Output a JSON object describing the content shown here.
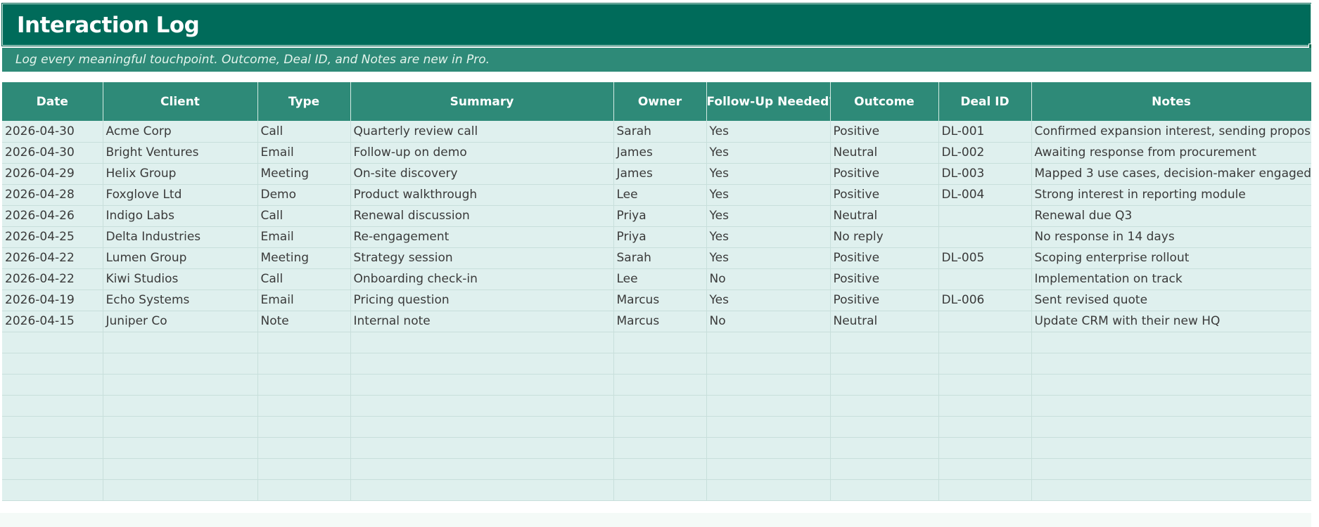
{
  "sheet": {
    "title": "Interaction Log",
    "subtitle": "Log every meaningful touchpoint. Outcome, Deal ID, and Notes are new in Pro."
  },
  "colors": {
    "title_bg": "#006b5a",
    "header_bg": "#2e8a78",
    "row_bg": "#dff0ee"
  },
  "columns": [
    "Date",
    "Client",
    "Type",
    "Summary",
    "Owner",
    "Follow-Up Needed?",
    "Outcome",
    "Deal ID",
    "Notes"
  ],
  "rows": [
    [
      "2026-04-30",
      "Acme Corp",
      "Call",
      "Quarterly review call",
      "Sarah",
      "Yes",
      "Positive",
      "DL-001",
      "Confirmed expansion interest, sending proposal"
    ],
    [
      "2026-04-30",
      "Bright Ventures",
      "Email",
      "Follow-up on demo",
      "James",
      "Yes",
      "Neutral",
      "DL-002",
      "Awaiting response from procurement"
    ],
    [
      "2026-04-29",
      "Helix Group",
      "Meeting",
      "On-site discovery",
      "James",
      "Yes",
      "Positive",
      "DL-003",
      "Mapped 3 use cases, decision-maker engaged"
    ],
    [
      "2026-04-28",
      "Foxglove Ltd",
      "Demo",
      "Product walkthrough",
      "Lee",
      "Yes",
      "Positive",
      "DL-004",
      "Strong interest in reporting module"
    ],
    [
      "2026-04-26",
      "Indigo Labs",
      "Call",
      "Renewal discussion",
      "Priya",
      "Yes",
      "Neutral",
      "",
      "Renewal due Q3"
    ],
    [
      "2026-04-25",
      "Delta Industries",
      "Email",
      "Re-engagement",
      "Priya",
      "Yes",
      "No reply",
      "",
      "No response in 14 days"
    ],
    [
      "2026-04-22",
      "Lumen Group",
      "Meeting",
      "Strategy session",
      "Sarah",
      "Yes",
      "Positive",
      "DL-005",
      "Scoping enterprise rollout"
    ],
    [
      "2026-04-22",
      "Kiwi Studios",
      "Call",
      "Onboarding check-in",
      "Lee",
      "No",
      "Positive",
      "",
      "Implementation on track"
    ],
    [
      "2026-04-19",
      "Echo Systems",
      "Email",
      "Pricing question",
      "Marcus",
      "Yes",
      "Positive",
      "DL-006",
      "Sent revised quote"
    ],
    [
      "2026-04-15",
      "Juniper Co",
      "Note",
      "Internal note",
      "Marcus",
      "No",
      "Neutral",
      "",
      "Update CRM with their new HQ"
    ],
    [
      "",
      "",
      "",
      "",
      "",
      "",
      "",
      "",
      ""
    ],
    [
      "",
      "",
      "",
      "",
      "",
      "",
      "",
      "",
      ""
    ],
    [
      "",
      "",
      "",
      "",
      "",
      "",
      "",
      "",
      ""
    ],
    [
      "",
      "",
      "",
      "",
      "",
      "",
      "",
      "",
      ""
    ],
    [
      "",
      "",
      "",
      "",
      "",
      "",
      "",
      "",
      ""
    ],
    [
      "",
      "",
      "",
      "",
      "",
      "",
      "",
      "",
      ""
    ],
    [
      "",
      "",
      "",
      "",
      "",
      "",
      "",
      "",
      ""
    ],
    [
      "",
      "",
      "",
      "",
      "",
      "",
      "",
      "",
      ""
    ]
  ]
}
